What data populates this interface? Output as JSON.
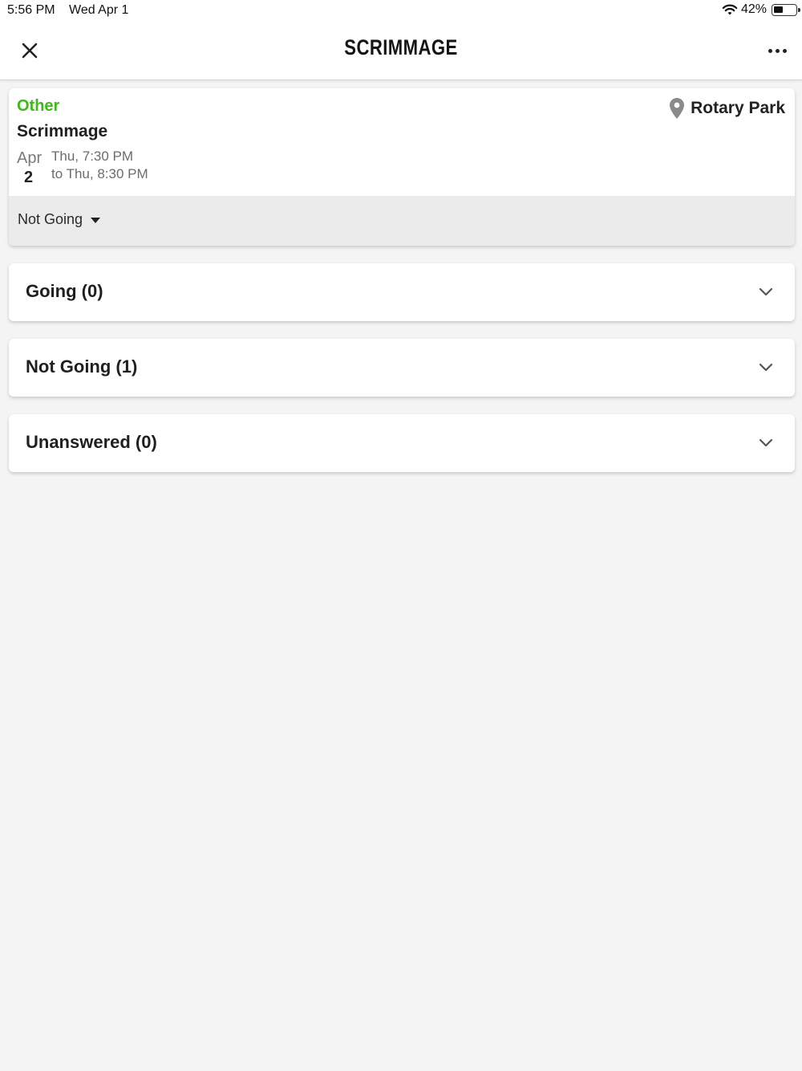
{
  "status_bar": {
    "time": "5:56 PM",
    "date": "Wed Apr 1",
    "battery": "42%"
  },
  "header": {
    "title": "SCRIMMAGE"
  },
  "event": {
    "type": "Other",
    "name": "Scrimmage",
    "month": "Apr",
    "day": "2",
    "start": "Thu, 7:30 PM",
    "end": "to Thu, 8:30 PM",
    "location": "Rotary Park",
    "rsvp": "Not Going"
  },
  "sections": [
    {
      "label": "Going (0)"
    },
    {
      "label": "Not Going (1)"
    },
    {
      "label": "Unanswered (0)"
    }
  ],
  "colors": {
    "accent_green": "#3fb91a",
    "background": "#f4f4f4"
  }
}
